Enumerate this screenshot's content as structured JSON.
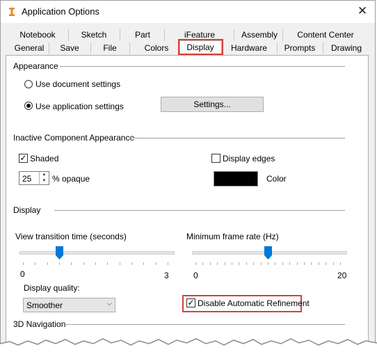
{
  "window": {
    "title": "Application Options",
    "close_glyph": "✕",
    "app_icon": "inventor-icon"
  },
  "tabs": {
    "row1": [
      "Notebook",
      "Sketch",
      "Part",
      "iFeature",
      "Assembly",
      "Content Center"
    ],
    "row2": [
      "General",
      "Save",
      "File",
      "Colors",
      "Display",
      "Hardware",
      "Prompts",
      "Drawing"
    ],
    "active": "Display"
  },
  "appearance": {
    "heading": "Appearance",
    "use_document": "Use document settings",
    "use_application": "Use application settings",
    "selected": "use_application",
    "settings_button": "Settings..."
  },
  "inactive": {
    "heading": "Inactive Component Appearance",
    "shaded_label": "Shaded",
    "shaded_checked": true,
    "display_edges_label": "Display edges",
    "display_edges_checked": false,
    "opaque_value": "25",
    "opaque_label": "% opaque",
    "color_label": "Color",
    "color_value": "#000000"
  },
  "display": {
    "heading": "Display",
    "view_transition_label": "View transition time (seconds)",
    "view_min": "0",
    "view_max": "3",
    "view_value_fraction": 0.25,
    "min_frame_label": "Minimum frame rate (Hz)",
    "frame_min": "0",
    "frame_max": "20",
    "frame_value": 10,
    "quality_label": "Display quality:",
    "quality_value": "Smoother",
    "disable_refinement_label": "Disable Automatic Refinement",
    "disable_refinement_checked": true
  },
  "nav": {
    "heading": "3D Navigation"
  },
  "colors": {
    "highlight": "#d9403a"
  }
}
